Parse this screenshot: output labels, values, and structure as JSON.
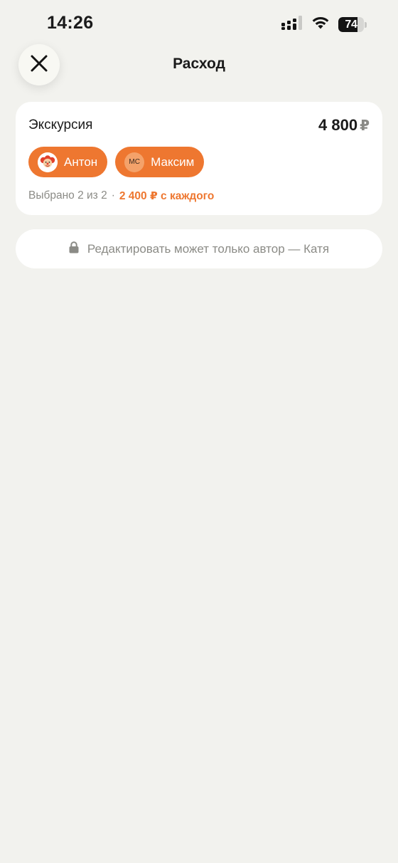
{
  "status_bar": {
    "time": "14:26",
    "battery": "74",
    "battery_level": 0.74
  },
  "header": {
    "title": "Расход",
    "close_icon": "close-icon"
  },
  "expense": {
    "name": "Экскурсия",
    "amount": "4 800",
    "currency": "₽",
    "participants": [
      {
        "name": "Антон",
        "avatar": "clown-avatar"
      },
      {
        "name": "Максим",
        "avatar_initials": "МС"
      }
    ],
    "selected_text": "Выбрано 2 из 2",
    "separator": "·",
    "per_person_text": "2 400 ₽ с каждого"
  },
  "notice": {
    "icon": "lock-icon",
    "text": "Редактировать может только автор — Катя"
  },
  "colors": {
    "accent": "#ee7730",
    "background": "#f2f2ee",
    "card": "#ffffff",
    "muted_text": "#8b8b86"
  }
}
